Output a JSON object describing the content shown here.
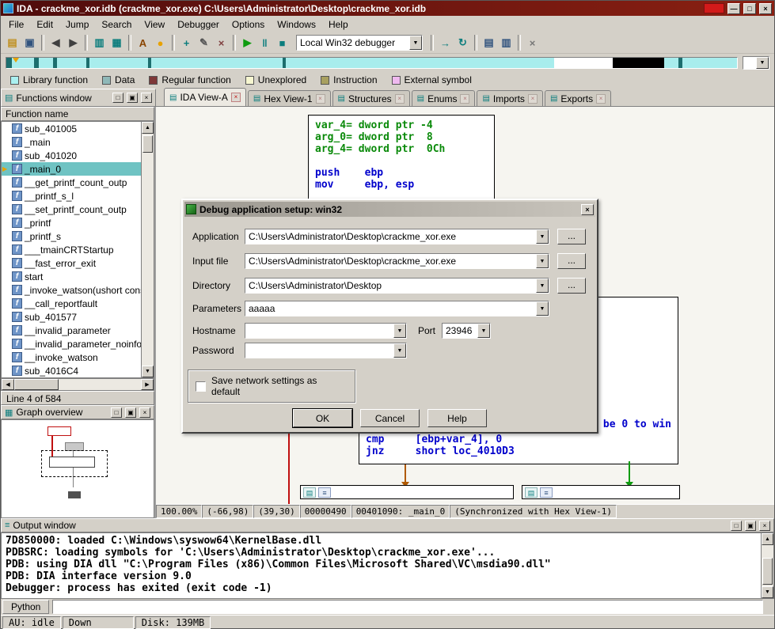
{
  "titlebar": {
    "title": "IDA - crackme_xor.idb (crackme_xor.exe) C:\\Users\\Administrator\\Desktop\\crackme_xor.idb"
  },
  "icons": {
    "minimize": "—",
    "maximize": "□",
    "float": "▣",
    "close": "×",
    "down_arrow": "▼",
    "up_arrow": "▲",
    "left_arrow": "◀",
    "right_arrow": "▶",
    "panel": "▤",
    "tab": "▤",
    "list": "≡",
    "overview": "▦",
    "output": "≡",
    "function_f": "f",
    "cursor": "▶"
  },
  "menu": {
    "items": [
      "File",
      "Edit",
      "Jump",
      "Search",
      "View",
      "Debugger",
      "Options",
      "Windows",
      "Help"
    ]
  },
  "toolbar": {
    "debugger": "Local Win32 debugger",
    "left_icons": [
      {
        "name": "open-file-icon",
        "glyph": "▤",
        "c": "#c09020"
      },
      {
        "name": "save-icon",
        "glyph": "▣",
        "c": "#31537e"
      },
      {
        "sep": true
      },
      {
        "name": "back-icon",
        "glyph": "◀",
        "c": "#404040"
      },
      {
        "name": "forward-icon",
        "glyph": "▶",
        "c": "#404040"
      },
      {
        "sep": true
      },
      {
        "name": "windows-list-icon",
        "glyph": "▥",
        "c": "#0b7d7d"
      },
      {
        "name": "desktop-icon",
        "glyph": "▦",
        "c": "#0b7d7d"
      },
      {
        "sep": true
      },
      {
        "name": "text-view-icon",
        "glyph": "A",
        "c": "#8a4500"
      },
      {
        "name": "colors-icon",
        "glyph": "●",
        "c": "#e8a200"
      },
      {
        "sep": true
      },
      {
        "name": "add-xref-icon",
        "glyph": "+",
        "c": "#0b7d7d"
      },
      {
        "name": "edit-icon",
        "glyph": "✎",
        "c": "#555555"
      },
      {
        "name": "delete-icon",
        "glyph": "×",
        "c": "#804040"
      },
      {
        "sep": true
      },
      {
        "name": "start-process-icon",
        "glyph": "▶",
        "c": "#0f9b0f"
      },
      {
        "name": "pause-process-icon",
        "glyph": "‖",
        "c": "#0b7d7d"
      },
      {
        "name": "stop-process-icon",
        "glyph": "■",
        "c": "#0b7d7d"
      }
    ],
    "right_icons": [
      {
        "sep": true
      },
      {
        "name": "attach-process-icon",
        "glyph": "→",
        "c": "#0b7d7d"
      },
      {
        "name": "refresh-icon",
        "glyph": "↻",
        "c": "#0b7d7d"
      },
      {
        "sep": true
      },
      {
        "name": "debugger-windows-icon",
        "glyph": "▤",
        "c": "#31537e"
      },
      {
        "name": "watch-list-icon",
        "glyph": "▥",
        "c": "#31537e"
      },
      {
        "sep": true
      },
      {
        "name": "close-view-icon",
        "glyph": "×",
        "c": "#777777"
      }
    ]
  },
  "navband": {
    "segments": [
      {
        "w": "0.8%",
        "c": "#1c6e6e"
      },
      {
        "w": "3%",
        "c": "#a8eded"
      },
      {
        "w": "0.6%",
        "c": "#1c6e6e"
      },
      {
        "w": "2%",
        "c": "#a8eded"
      },
      {
        "w": "0.5%",
        "c": "#1c6e6e"
      },
      {
        "w": "4%",
        "c": "#a8eded"
      },
      {
        "w": "0.5%",
        "c": "#1c6e6e"
      },
      {
        "w": "8%",
        "c": "#a8eded"
      },
      {
        "w": "0.4%",
        "c": "#1c6e6e"
      },
      {
        "w": "18%",
        "c": "#a8eded"
      },
      {
        "w": "0.4%",
        "c": "#1c6e6e"
      },
      {
        "w": "36.8%",
        "c": "#a8eded"
      },
      {
        "w": "8%",
        "c": "#ffffff"
      },
      {
        "w": "7%",
        "c": "#000000"
      },
      {
        "w": "2%",
        "c": "#a8eded"
      },
      {
        "w": "0.5%",
        "c": "#1c6e6e"
      },
      {
        "w": "7.5%",
        "c": "#a8eded"
      }
    ]
  },
  "legend": {
    "items": [
      {
        "label": "Library function",
        "c": "#aaf0f0"
      },
      {
        "label": "Data",
        "c": "#8fb8b8"
      },
      {
        "label": "Regular function",
        "c": "#7e3838"
      },
      {
        "label": "Unexplored",
        "c": "#f6f6d0"
      },
      {
        "label": "Instruction",
        "c": "#a8a060"
      },
      {
        "label": "External symbol",
        "c": "#efb9ef"
      }
    ]
  },
  "tabs": {
    "items": [
      {
        "label": "IDA View-A",
        "active": true
      },
      {
        "label": "Hex View-1"
      },
      {
        "label": "Structures"
      },
      {
        "label": "Enums"
      },
      {
        "label": "Imports"
      },
      {
        "label": "Exports"
      }
    ]
  },
  "functions": {
    "panel_title": "Functions window",
    "header": "Function name",
    "status": "Line 4 of 584",
    "items": [
      {
        "label": "sub_401005"
      },
      {
        "label": "_main"
      },
      {
        "label": "sub_401020"
      },
      {
        "label": "_main_0",
        "selected": true
      },
      {
        "label": "__get_printf_count_outp"
      },
      {
        "label": "__printf_s_l"
      },
      {
        "label": "__set_printf_count_outp"
      },
      {
        "label": "_printf"
      },
      {
        "label": "_printf_s"
      },
      {
        "label": "___tmainCRTStartup"
      },
      {
        "label": "__fast_error_exit"
      },
      {
        "label": "start"
      },
      {
        "label": "_invoke_watson(ushort const"
      },
      {
        "label": "__call_reportfault"
      },
      {
        "label": "sub_401577"
      },
      {
        "label": "__invalid_parameter"
      },
      {
        "label": "__invalid_parameter_noinfo"
      },
      {
        "label": "__invoke_watson"
      },
      {
        "label": "sub_4016C4"
      }
    ]
  },
  "overview": {
    "title": "Graph overview"
  },
  "disasm": {
    "node1": [
      {
        "t": "var_4= dword ptr -4",
        "c": "#0a8a0a"
      },
      {
        "t": "arg_0= dword ptr  8",
        "c": "#0a8a0a"
      },
      {
        "t": "arg_4= dword ptr  0Ch",
        "c": "#0a8a0a"
      },
      {
        "t": "",
        "c": "#0000cc"
      },
      {
        "t": "push    ebp",
        "c": "#0000cc"
      },
      {
        "t": "mov     ebp, esp",
        "c": "#0000cc"
      }
    ],
    "note": "b be 0 to win",
    "node2": [
      {
        "t": "cmp     [ebp+var_4], 0",
        "c": "#0000cc"
      },
      {
        "t": "jnz     short loc_4010D3",
        "c": "#0000cc"
      }
    ]
  },
  "main_status": {
    "segments": [
      "100.00%",
      "(-66,98)",
      "(39,30)",
      "00000490",
      "00401090: _main_0",
      "(Synchronized with Hex View-1)"
    ]
  },
  "output": {
    "title": "Output window",
    "python_tab": "Python",
    "lines": [
      "7D850000: loaded C:\\Windows\\syswow64\\KernelBase.dll",
      "PDBSRC: loading symbols for 'C:\\Users\\Administrator\\Desktop\\crackme_xor.exe'...",
      "PDB: using DIA dll \"C:\\Program Files (x86)\\Common Files\\Microsoft Shared\\VC\\msdia90.dll\"",
      "PDB: DIA interface version 9.0",
      "Debugger: process has exited (exit code -1)"
    ]
  },
  "statusbar": {
    "au": "AU: idle",
    "down": "Down",
    "disk": "Disk: 139MB"
  },
  "dialog": {
    "title": "Debug application setup: win32",
    "application_label": "Application",
    "application_value": "C:\\Users\\Administrator\\Desktop\\crackme_xor.exe",
    "input_label": "Input file",
    "input_value": "C:\\Users\\Administrator\\Desktop\\crackme_xor.exe",
    "directory_label": "Directory",
    "directory_value": "C:\\Users\\Administrator\\Desktop",
    "parameters_label": "Parameters",
    "parameters_value": "aaaaa",
    "hostname_label": "Hostname",
    "hostname_value": "",
    "port_label": "Port",
    "port_value": "23946",
    "password_label": "Password",
    "password_value": "",
    "browse_label": "...",
    "checkbox_label": "Save network settings as default",
    "ok_label": "OK",
    "cancel_label": "Cancel",
    "help_label": "Help"
  }
}
